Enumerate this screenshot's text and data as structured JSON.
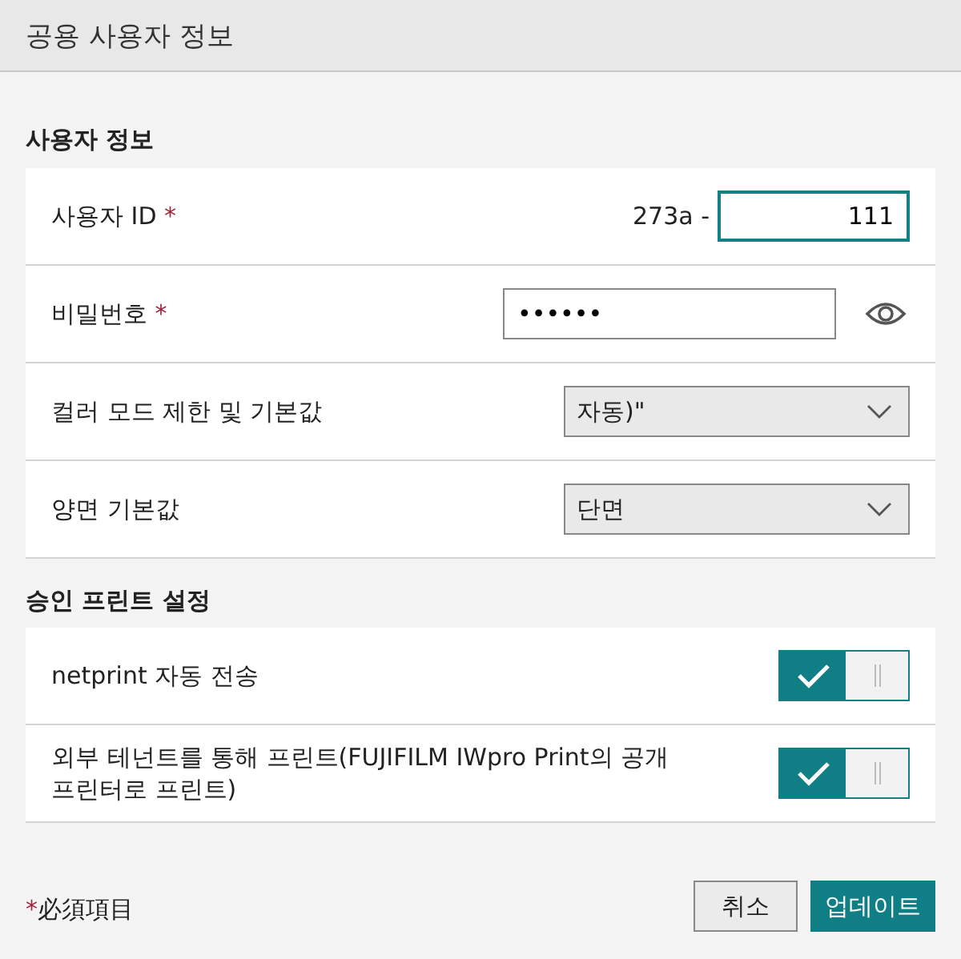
{
  "dialog": {
    "title": "공용 사용자 정보"
  },
  "sections": [
    {
      "heading": "사용자 정보",
      "rows": [
        {
          "kind": "id",
          "label": "사용자 ID",
          "required": true,
          "prefix": "273a -",
          "value": "111",
          "focused": true
        },
        {
          "kind": "password",
          "label": "비밀번호",
          "required": true,
          "value": "••••••"
        },
        {
          "kind": "select",
          "label": "컬러 모드 제한 및 기본값",
          "value": "자동)\""
        },
        {
          "kind": "select",
          "label": "양면 기본값",
          "value": "단면"
        }
      ]
    },
    {
      "heading": "승인 프린트 설정",
      "rows": [
        {
          "kind": "toggle",
          "label": "netprint 자동 전송",
          "on": true
        },
        {
          "kind": "toggle",
          "label": "외부 테넌트를 통해 프린트(FUJIFILM IWpro Print의 공개 프린터로 프린트)",
          "on": true
        }
      ]
    }
  ],
  "footer": {
    "required_mark": "*",
    "required_note": "必須項目",
    "buttons": [
      {
        "label": "취소",
        "kind": "secondary"
      },
      {
        "label": "업데이트",
        "kind": "primary"
      }
    ]
  }
}
